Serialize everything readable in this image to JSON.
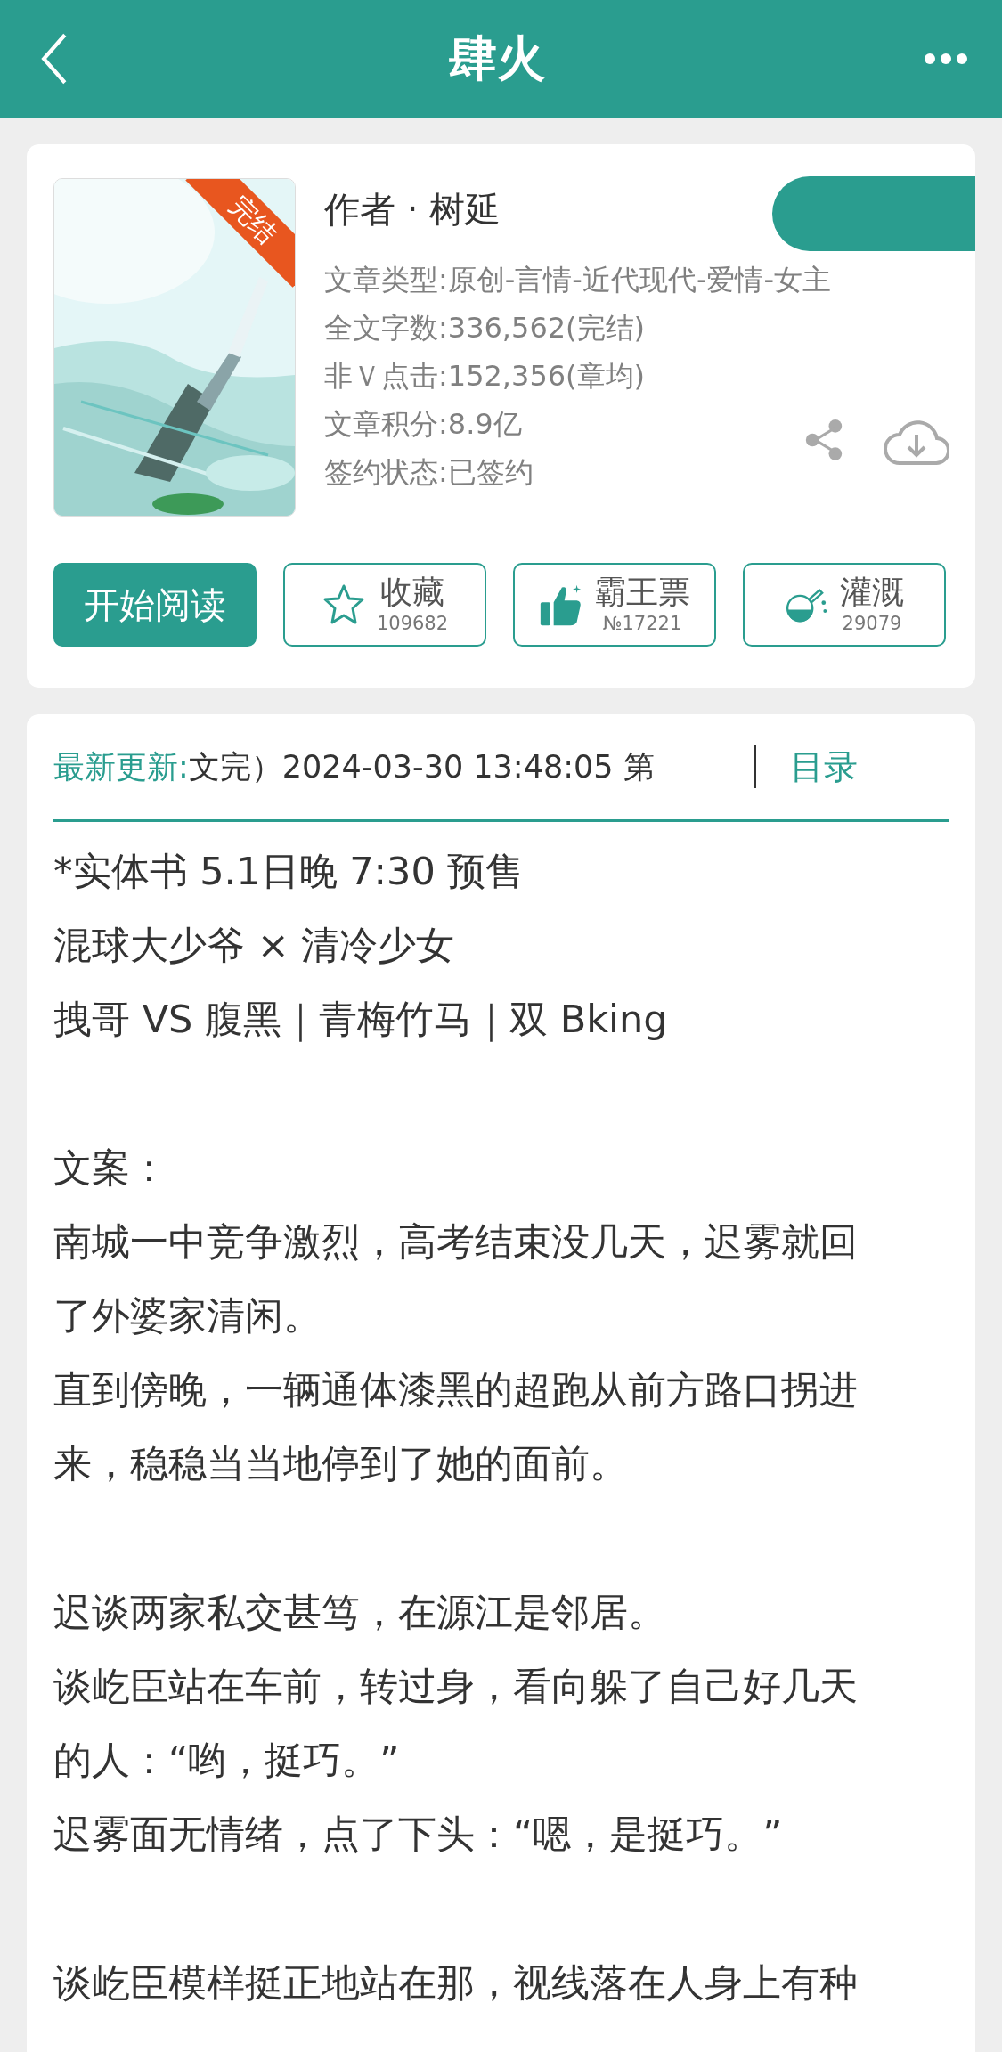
{
  "header": {
    "title": "肆火"
  },
  "book": {
    "cover": {
      "kind": "picture",
      "badge": "完结"
    },
    "author": "作者 · 树延",
    "info": [
      "文章类型:原创-言情-近代现代-爱情-女主",
      "全文字数:336,562(完结)",
      "非Ｖ点击:152,356(章均)",
      "文章积分:8.9亿",
      "签约状态:已签约"
    ]
  },
  "actions": [
    {
      "kind": "primary",
      "label": "开始阅读"
    },
    {
      "kind": "star",
      "label": "收藏",
      "count": "109682"
    },
    {
      "kind": "thumb",
      "label": "霸王票",
      "count": "№17221"
    },
    {
      "kind": "flask",
      "label": "灌溉",
      "count": "29079"
    }
  ],
  "update": {
    "label": "最新更新:",
    "text": "文完）2024-03-30 13:48:05   第",
    "link": "目录"
  },
  "synopsis": [
    {
      "kind": "line",
      "text": "*实体书 5.1日晚 7:30 预售"
    },
    {
      "kind": "line",
      "text": "混球大少爷 × 清冷少女"
    },
    {
      "kind": "line",
      "text": "拽哥 VS 腹黑｜青梅竹马｜双 Bking"
    },
    {
      "kind": "blank"
    },
    {
      "kind": "line",
      "text": "文案："
    },
    {
      "kind": "line",
      "text": "南城一中竞争激烈，高考结束没几天，迟雾就回了外婆家清闲。"
    },
    {
      "kind": "line",
      "text": "直到傍晚，一辆通体漆黑的超跑从前方路口拐进来，稳稳当当地停到了她的面前。"
    },
    {
      "kind": "blank"
    },
    {
      "kind": "line",
      "text": "迟谈两家私交甚笃，在源江是邻居。"
    },
    {
      "kind": "line",
      "text": "谈屹臣站在车前，转过身，看向躲了自己好几天的人：“哟，挺巧。”"
    },
    {
      "kind": "line",
      "text": "迟雾面无情绪，点了下头：“嗯，是挺巧。”"
    },
    {
      "kind": "blank"
    },
    {
      "kind": "line",
      "text": "谈屹臣模样挺正地站在那，视线落在人身上有种"
    }
  ]
}
